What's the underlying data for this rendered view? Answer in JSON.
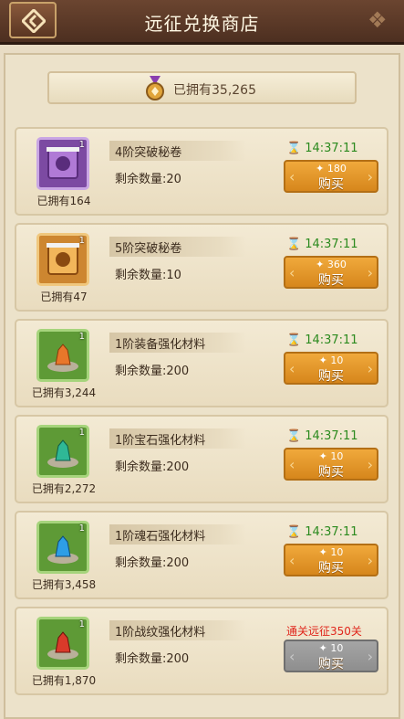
{
  "header": {
    "title": "远征兑换商店"
  },
  "owned": {
    "text": "已拥有35,265"
  },
  "items": [
    {
      "name": "4阶突破秘卷",
      "remaining": "剩余数量:20",
      "owned": "已拥有164",
      "qty": "1",
      "icon": "purple-scroll-icon",
      "timer": "14:37:11",
      "price": "180",
      "buy": "购买",
      "status": "available"
    },
    {
      "name": "5阶突破秘卷",
      "remaining": "剩余数量:10",
      "owned": "已拥有47",
      "qty": "1",
      "icon": "orange-scroll-icon",
      "timer": "14:37:11",
      "price": "360",
      "buy": "购买",
      "status": "available"
    },
    {
      "name": "1阶装备强化材料",
      "remaining": "剩余数量:200",
      "owned": "已拥有3,244",
      "qty": "1",
      "icon": "orange-crystal-icon",
      "timer": "14:37:11",
      "price": "10",
      "buy": "购买",
      "status": "available"
    },
    {
      "name": "1阶宝石强化材料",
      "remaining": "剩余数量:200",
      "owned": "已拥有2,272",
      "qty": "1",
      "icon": "teal-crystal-icon",
      "timer": "14:37:11",
      "price": "10",
      "buy": "购买",
      "status": "available"
    },
    {
      "name": "1阶魂石强化材料",
      "remaining": "剩余数量:200",
      "owned": "已拥有3,458",
      "qty": "1",
      "icon": "blue-crystal-icon",
      "timer": "14:37:11",
      "price": "10",
      "buy": "购买",
      "status": "available"
    },
    {
      "name": "1阶战纹强化材料",
      "remaining": "剩余数量:200",
      "owned": "已拥有1,870",
      "qty": "1",
      "icon": "red-crystal-icon",
      "lock": "通关远征350关",
      "price": "10",
      "buy": "购买",
      "status": "locked"
    }
  ],
  "colors": {
    "header": "#5a3826",
    "timer": "#2b8a1e",
    "lock": "#e0251b",
    "button": "#e39a2e",
    "button_disabled": "#999999"
  }
}
